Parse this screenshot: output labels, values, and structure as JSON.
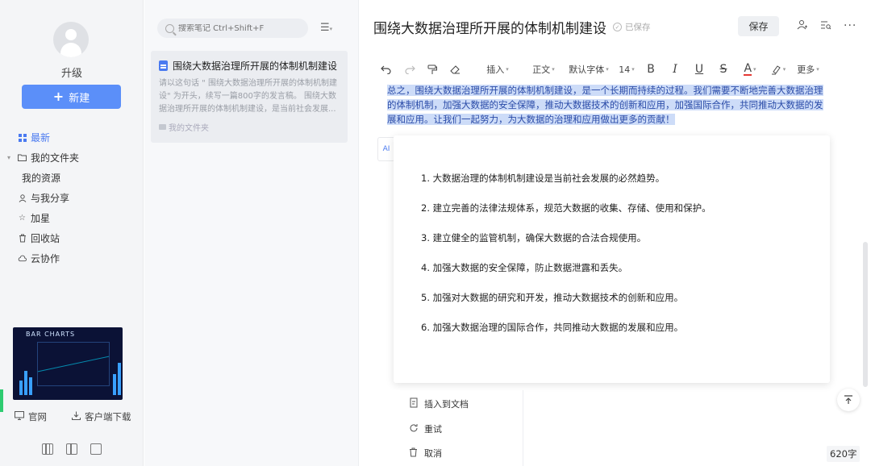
{
  "sidebar": {
    "upgrade_label": "升级",
    "new_button_label": "新建",
    "nav": [
      {
        "label": "最新",
        "icon": "grid-icon",
        "active": true
      },
      {
        "label": "我的文件夹",
        "icon": "folder-icon"
      },
      {
        "label": "我的资源",
        "icon": ""
      },
      {
        "label": "与我分享",
        "icon": "user-icon"
      },
      {
        "label": "加星",
        "icon": "star-icon"
      },
      {
        "label": "回收站",
        "icon": "trash-icon"
      },
      {
        "label": "云协作",
        "icon": "cloud-icon"
      }
    ],
    "promo_title": "BAR CHARTS",
    "official_site_label": "官网",
    "client_download_label": "客户端下载",
    "accent_color": "#5b8ff9"
  },
  "notelist": {
    "search_placeholder": "搜索笔记 Ctrl+Shift+F",
    "note": {
      "title": "围绕大数据治理所开展的体制机制建设",
      "snippet": "请以这句话 \" 围绕大数据治理所开展的体制机制建设\" 为开头，续写一篇800字的发言稿。 围绕大数据治理所开展的体制机制建设，是当前社会发展...",
      "folder": "我的文件夹"
    }
  },
  "editor": {
    "title": "围绕大数据治理所开展的体制机制建设",
    "saved_status": "已保存",
    "save_button_label": "保存",
    "toolbar": {
      "insert": "插入",
      "paragraph": "正文",
      "font": "默认字体",
      "size": "14",
      "bold": "B",
      "italic": "I",
      "underline": "U",
      "strike": "S",
      "font_color": "A",
      "more": "更多"
    },
    "highlighted_text": "总之，围绕大数据治理所开展的体制机制建设，是一个长期而持续的过程。我们需要不断地完善大数据治理的体制机制，加强大数据的安全保障，推动大数据技术的创新和应用，加强国际合作，共同推动大数据的发展和应用。让我们一起努力，为大数据的治理和应用做出更多的贡献！",
    "ai_badge": "AI",
    "ai_list": [
      "1. 大数据治理的体制机制建设是当前社会发展的必然趋势。",
      "2. 建立完善的法律法规体系，规范大数据的收集、存储、使用和保护。",
      "3. 建立健全的监管机制，确保大数据的合法合规使用。",
      "4. 加强大数据的安全保障，防止数据泄露和丢失。",
      "5. 加强对大数据的研究和开发，推动大数据技术的创新和应用。",
      "6. 加强大数据治理的国际合作，共同推动大数据的发展和应用。"
    ],
    "ai_actions": {
      "insert": "插入到文档",
      "retry": "重试",
      "cancel": "取消"
    },
    "word_count": "620字",
    "highlight_color": "#cddcf8"
  }
}
